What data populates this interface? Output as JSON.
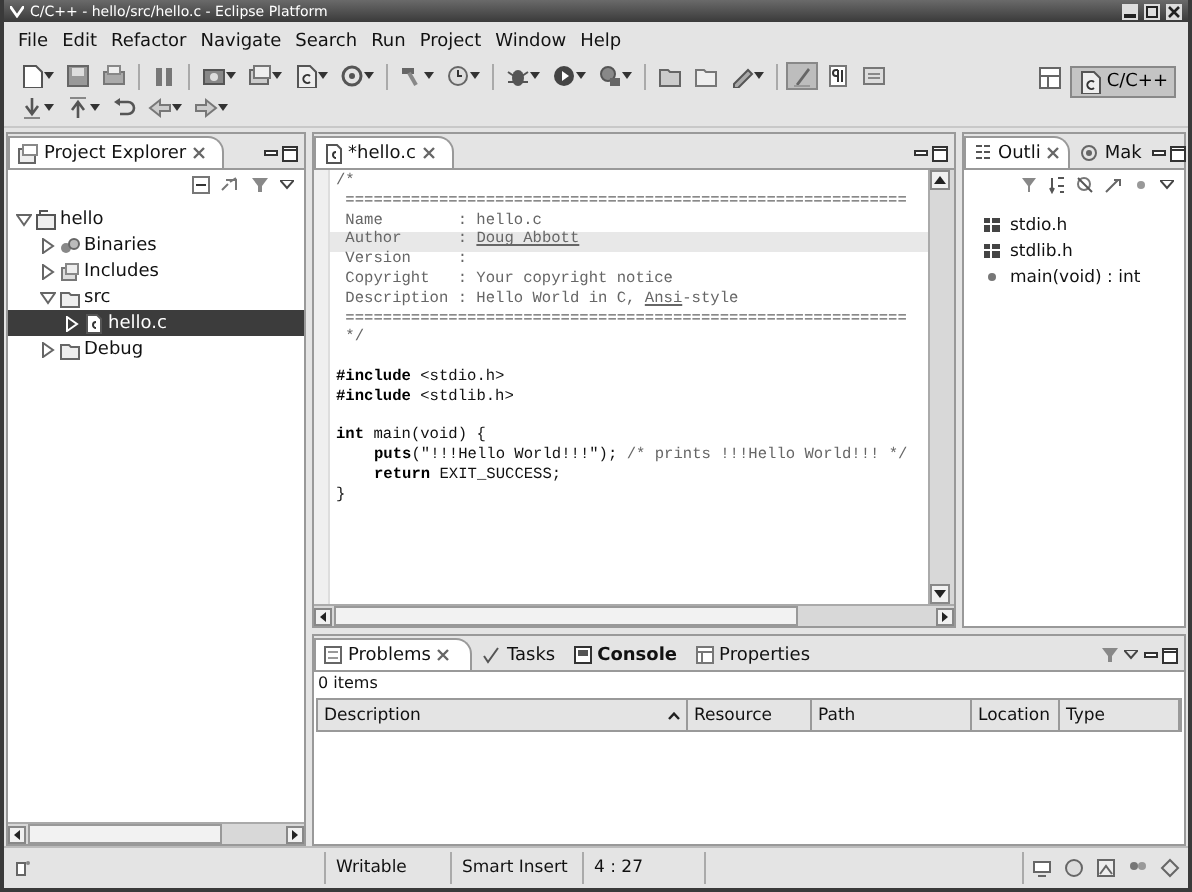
{
  "window": {
    "title": "C/C++ - hello/src/hello.c - Eclipse Platform"
  },
  "menu": [
    "File",
    "Edit",
    "Refactor",
    "Navigate",
    "Search",
    "Run",
    "Project",
    "Window",
    "Help"
  ],
  "toolbar": {
    "rows": [
      [
        {
          "kind": "button",
          "dropdown": true,
          "pressed": false
        },
        {
          "kind": "button",
          "dropdown": false,
          "pressed": false
        },
        {
          "kind": "button",
          "dropdown": false,
          "pressed": false
        },
        {
          "kind": "separator"
        },
        {
          "kind": "button",
          "dropdown": false,
          "pressed": false
        },
        {
          "kind": "separator"
        },
        {
          "kind": "button",
          "dropdown": true,
          "pressed": false
        },
        {
          "kind": "button",
          "dropdown": true,
          "pressed": false
        },
        {
          "kind": "button",
          "dropdown": true,
          "pressed": false
        },
        {
          "kind": "button",
          "dropdown": true,
          "pressed": false
        },
        {
          "kind": "separator"
        },
        {
          "kind": "button",
          "dropdown": true,
          "pressed": false
        },
        {
          "kind": "button",
          "dropdown": true,
          "pressed": false
        },
        {
          "kind": "separator"
        },
        {
          "kind": "button",
          "dropdown": true,
          "pressed": false
        },
        {
          "kind": "button",
          "dropdown": true,
          "pressed": false
        },
        {
          "kind": "button",
          "dropdown": true,
          "pressed": false
        },
        {
          "kind": "separator"
        },
        {
          "kind": "button",
          "dropdown": false,
          "pressed": false
        },
        {
          "kind": "button",
          "dropdown": false,
          "pressed": false
        },
        {
          "kind": "button",
          "dropdown": true,
          "pressed": false
        },
        {
          "kind": "separator"
        },
        {
          "kind": "button",
          "dropdown": false,
          "pressed": true
        },
        {
          "kind": "button",
          "dropdown": false,
          "pressed": false
        },
        {
          "kind": "button",
          "dropdown": false,
          "pressed": false
        }
      ],
      [
        {
          "kind": "button",
          "dropdown": true,
          "pressed": false
        },
        {
          "kind": "button",
          "dropdown": true,
          "pressed": false
        },
        {
          "kind": "button",
          "dropdown": false,
          "pressed": false
        },
        {
          "kind": "button",
          "dropdown": true,
          "pressed": false
        },
        {
          "kind": "button",
          "dropdown": true,
          "pressed": false
        }
      ]
    ],
    "perspective": {
      "label": "C/C++",
      "selected": true
    }
  },
  "project_explorer": {
    "tab": "Project Explorer",
    "tree": [
      {
        "label": "hello",
        "kind": "project",
        "expanded": true,
        "selected": false,
        "children": [
          {
            "label": "Binaries",
            "kind": "binaries",
            "expanded": false,
            "selected": false
          },
          {
            "label": "Includes",
            "kind": "includes",
            "expanded": false,
            "selected": false
          },
          {
            "label": "src",
            "kind": "folder",
            "expanded": true,
            "selected": false,
            "children": [
              {
                "label": "hello.c",
                "kind": "file",
                "expanded": false,
                "selected": true
              }
            ]
          },
          {
            "label": "Debug",
            "kind": "folder",
            "expanded": false,
            "selected": false
          }
        ]
      }
    ]
  },
  "editor": {
    "tab": "*hello.c",
    "lines": [
      {
        "kind": "code",
        "current": false,
        "segments": [
          {
            "kind": "comment",
            "text": "/*"
          }
        ]
      },
      {
        "kind": "code",
        "current": false,
        "segments": [
          {
            "kind": "comment",
            "text": " ============================================================"
          }
        ]
      },
      {
        "kind": "code",
        "current": false,
        "segments": [
          {
            "kind": "comment",
            "text": " Name        : hello.c"
          }
        ]
      },
      {
        "kind": "code",
        "current": true,
        "segments": [
          {
            "kind": "comment",
            "text": " Author      : "
          },
          {
            "kind": "spelling",
            "text": "Doug Abbott"
          }
        ]
      },
      {
        "kind": "code",
        "current": false,
        "segments": [
          {
            "kind": "comment",
            "text": " Version     :"
          }
        ]
      },
      {
        "kind": "code",
        "current": false,
        "segments": [
          {
            "kind": "comment",
            "text": " Copyright   : Your copyright notice"
          }
        ]
      },
      {
        "kind": "code",
        "current": false,
        "segments": [
          {
            "kind": "comment",
            "text": " Description : Hello World in C, "
          },
          {
            "kind": "spelling",
            "text": "Ansi"
          },
          {
            "kind": "comment",
            "text": "-style"
          }
        ]
      },
      {
        "kind": "code",
        "current": false,
        "segments": [
          {
            "kind": "comment",
            "text": " ============================================================"
          }
        ]
      },
      {
        "kind": "code",
        "current": false,
        "segments": [
          {
            "kind": "comment",
            "text": " */"
          }
        ]
      },
      {
        "kind": "blank"
      },
      {
        "kind": "code",
        "current": false,
        "segments": [
          {
            "kind": "keyword",
            "text": "#include"
          },
          {
            "kind": "plain",
            "text": " <stdio.h>"
          }
        ]
      },
      {
        "kind": "code",
        "current": false,
        "segments": [
          {
            "kind": "keyword",
            "text": "#include"
          },
          {
            "kind": "plain",
            "text": " <stdlib.h>"
          }
        ]
      },
      {
        "kind": "blank"
      },
      {
        "kind": "code",
        "current": false,
        "segments": [
          {
            "kind": "keyword",
            "text": "int"
          },
          {
            "kind": "plain",
            "text": " main(void) {"
          }
        ]
      },
      {
        "kind": "indented",
        "current": false,
        "segments": [
          {
            "kind": "keyword",
            "text": "puts"
          },
          {
            "kind": "plain",
            "text": "(\"!!!Hello World!!!\"); "
          },
          {
            "kind": "comment",
            "text": "/* prints !!!Hello World!!! */"
          }
        ]
      },
      {
        "kind": "indented",
        "current": false,
        "segments": [
          {
            "kind": "keyword",
            "text": "return"
          },
          {
            "kind": "plain",
            "text": " EXIT_SUCCESS;"
          }
        ]
      },
      {
        "kind": "code",
        "current": false,
        "segments": [
          {
            "kind": "plain",
            "text": "}"
          }
        ]
      }
    ]
  },
  "side_tabs": [
    {
      "label": "Outli",
      "selected": true
    },
    {
      "label": "Mak",
      "selected": false
    }
  ],
  "outline": [
    {
      "label": "stdio.h",
      "kind": "include"
    },
    {
      "label": "stdlib.h",
      "kind": "include"
    },
    {
      "label": "main(void) : int",
      "kind": "function"
    }
  ],
  "bottom_tabs": [
    {
      "label": "Problems",
      "selected": true,
      "changed": false
    },
    {
      "label": "Tasks",
      "selected": false,
      "changed": false
    },
    {
      "label": "Console",
      "selected": false,
      "changed": true
    },
    {
      "label": "Properties",
      "selected": false,
      "changed": false
    }
  ],
  "problems": {
    "summary": "0 items",
    "columns": [
      {
        "label": "Description",
        "sorted": true
      },
      {
        "label": "Resource",
        "sorted": false
      },
      {
        "label": "Path",
        "sorted": false
      },
      {
        "label": "Location",
        "sorted": false
      },
      {
        "label": "Type",
        "sorted": false
      }
    ]
  },
  "status_bar": [
    "Writable",
    "Smart Insert",
    "4 : 27"
  ]
}
